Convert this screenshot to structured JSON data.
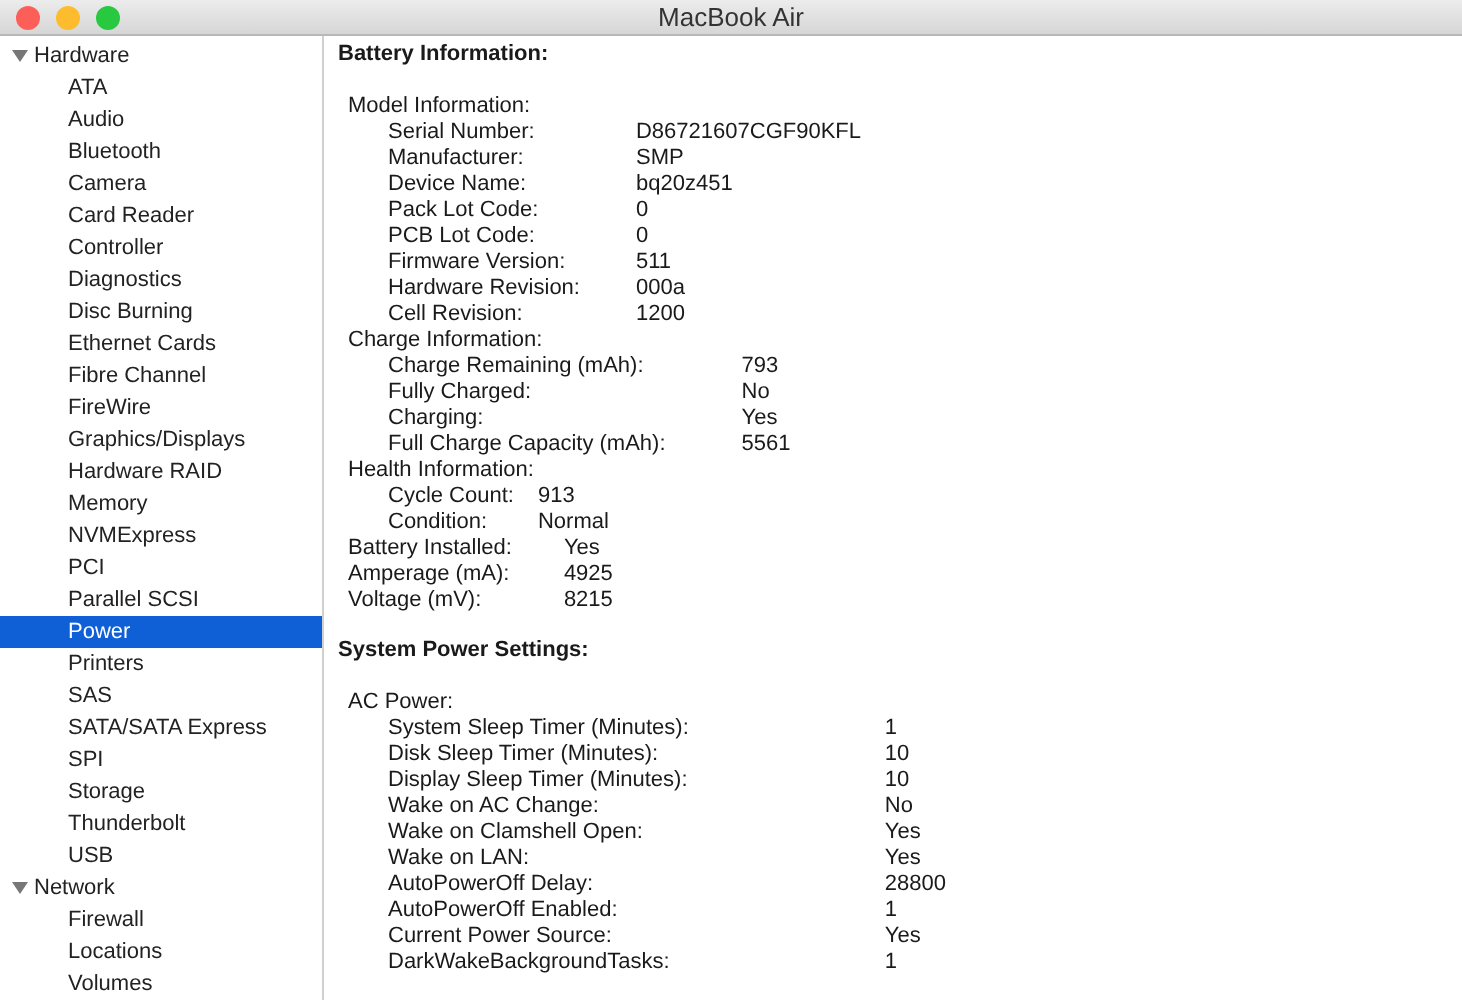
{
  "window": {
    "title": "MacBook Air"
  },
  "sidebar": {
    "items": [
      {
        "label": "Hardware",
        "expanded": true,
        "selected": false,
        "children": [
          {
            "label": "ATA",
            "selected": false
          },
          {
            "label": "Audio",
            "selected": false
          },
          {
            "label": "Bluetooth",
            "selected": false
          },
          {
            "label": "Camera",
            "selected": false
          },
          {
            "label": "Card Reader",
            "selected": false
          },
          {
            "label": "Controller",
            "selected": false
          },
          {
            "label": "Diagnostics",
            "selected": false
          },
          {
            "label": "Disc Burning",
            "selected": false
          },
          {
            "label": "Ethernet Cards",
            "selected": false
          },
          {
            "label": "Fibre Channel",
            "selected": false
          },
          {
            "label": "FireWire",
            "selected": false
          },
          {
            "label": "Graphics/Displays",
            "selected": false
          },
          {
            "label": "Hardware RAID",
            "selected": false
          },
          {
            "label": "Memory",
            "selected": false
          },
          {
            "label": "NVMExpress",
            "selected": false
          },
          {
            "label": "PCI",
            "selected": false
          },
          {
            "label": "Parallel SCSI",
            "selected": false
          },
          {
            "label": "Power",
            "selected": true
          },
          {
            "label": "Printers",
            "selected": false
          },
          {
            "label": "SAS",
            "selected": false
          },
          {
            "label": "SATA/SATA Express",
            "selected": false
          },
          {
            "label": "SPI",
            "selected": false
          },
          {
            "label": "Storage",
            "selected": false
          },
          {
            "label": "Thunderbolt",
            "selected": false
          },
          {
            "label": "USB",
            "selected": false
          }
        ]
      },
      {
        "label": "Network",
        "expanded": true,
        "selected": false,
        "children": [
          {
            "label": "Firewall",
            "selected": false
          },
          {
            "label": "Locations",
            "selected": false
          },
          {
            "label": "Volumes",
            "selected": false
          }
        ]
      }
    ]
  },
  "content": {
    "sections": [
      {
        "title": "Battery Information:",
        "items": [
          {
            "kind": "group",
            "label": "Model Information:",
            "rows": [
              {
                "label": "Serial Number:",
                "value": "D86721607CGF90KFL"
              },
              {
                "label": "Manufacturer:",
                "value": "SMP"
              },
              {
                "label": "Device Name:",
                "value": "bq20z451"
              },
              {
                "label": "Pack Lot Code:",
                "value": "0"
              },
              {
                "label": "PCB Lot Code:",
                "value": "0"
              },
              {
                "label": "Firmware Version:",
                "value": "511"
              },
              {
                "label": "Hardware Revision:",
                "value": "000a"
              },
              {
                "label": "Cell Revision:",
                "value": "1200"
              }
            ]
          },
          {
            "kind": "group",
            "label": "Charge Information:",
            "rows": [
              {
                "label": "Charge Remaining (mAh):",
                "value": "793"
              },
              {
                "label": "Fully Charged:",
                "value": "No"
              },
              {
                "label": "Charging:",
                "value": "Yes"
              },
              {
                "label": "Full Charge Capacity (mAh):",
                "value": "5561"
              }
            ]
          },
          {
            "kind": "group",
            "label": "Health Information:",
            "rows": [
              {
                "label": "Cycle Count:",
                "value": "913"
              },
              {
                "label": "Condition:",
                "value": "Normal"
              }
            ]
          },
          {
            "kind": "pairs",
            "rows": [
              {
                "label": "Battery Installed:",
                "value": "Yes"
              },
              {
                "label": "Amperage (mA):",
                "value": "4925"
              },
              {
                "label": "Voltage (mV):",
                "value": "8215"
              }
            ]
          }
        ]
      },
      {
        "title": "System Power Settings:",
        "items": [
          {
            "kind": "group",
            "label": "AC Power:",
            "rows": [
              {
                "label": "System Sleep Timer (Minutes):",
                "value": "1"
              },
              {
                "label": "Disk Sleep Timer (Minutes):",
                "value": "10"
              },
              {
                "label": "Display Sleep Timer (Minutes):",
                "value": "10"
              },
              {
                "label": "Wake on AC Change:",
                "value": "No"
              },
              {
                "label": "Wake on Clamshell Open:",
                "value": "Yes"
              },
              {
                "label": "Wake on LAN:",
                "value": "Yes"
              },
              {
                "label": "AutoPowerOff Delay:",
                "value": "28800"
              },
              {
                "label": "AutoPowerOff Enabled:",
                "value": "1"
              },
              {
                "label": "Current Power Source:",
                "value": "Yes"
              },
              {
                "label": "DarkWakeBackgroundTasks:",
                "value": "1"
              }
            ]
          }
        ]
      }
    ]
  }
}
